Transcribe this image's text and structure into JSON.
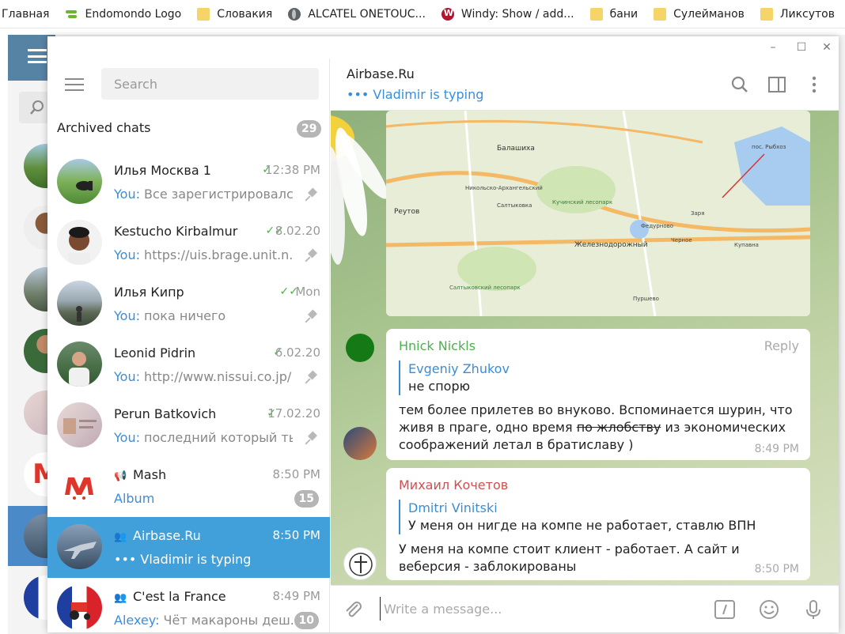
{
  "bookmarks": [
    {
      "label": "Главная",
      "icon": "none"
    },
    {
      "label": "Endomondo Logo",
      "icon": "endomondo-icon"
    },
    {
      "label": "Словакия",
      "icon": "folder-icon"
    },
    {
      "label": "ALCATEL ONETOUC...",
      "icon": "globe-icon"
    },
    {
      "label": "Windy: Show / add...",
      "icon": "windy-icon"
    },
    {
      "label": "бани",
      "icon": "folder-icon"
    },
    {
      "label": "Сулейманов",
      "icon": "folder-icon"
    },
    {
      "label": "Ликсутов",
      "icon": "folder-icon"
    }
  ],
  "window": {
    "minimize": "–",
    "maximize": "☐",
    "close": "✕"
  },
  "sidebar": {
    "search_placeholder": "Search",
    "archived_label": "Archived chats",
    "archived_count": "29",
    "chats": [
      {
        "name": "Илья Москва 1",
        "time": "12:38 PM",
        "you": "You:",
        "preview": " Все зарегистрировалс...",
        "check": "✓",
        "pinned": true
      },
      {
        "name": "Kestucho Kirbalmur",
        "time": "8.02.20",
        "you": "You:",
        "preview": " https://uis.brage.unit.n...",
        "check": "✓✓",
        "pinned": true
      },
      {
        "name": "Илья Кипр",
        "time": "Mon",
        "you": "You:",
        "preview": " пока ничего",
        "check": "✓✓",
        "pinned": true
      },
      {
        "name": "Leonid Pidrin",
        "time": "6.02.20",
        "you": "You:",
        "preview": " http://www.nissui.co.jp/...",
        "check": "✓",
        "pinned": true
      },
      {
        "name": "Perun Batkovich",
        "time": "17.02.20",
        "you": "You:",
        "preview": " последний который ты...",
        "check": "✓",
        "pinned": true
      },
      {
        "name": "Mash",
        "time": "8:50 PM",
        "you": "",
        "preview": "Album",
        "badge": "15"
      },
      {
        "name": "Airbase.Ru",
        "time": "8:50 PM",
        "you": "",
        "preview": "••• Vladimir is typing"
      },
      {
        "name": "C'est la France",
        "time": "8:49 PM",
        "you": "Alexey:",
        "preview": " Чёт макароны деш...",
        "badge": "10"
      }
    ]
  },
  "chat": {
    "title": "Airbase.Ru",
    "status": "••• Vladimir is typing",
    "map_labels": [
      "Балашиха",
      "Реутов",
      "Никольско-Архангельский",
      "Салтыковка",
      "Кучинский лесопарк",
      "Железнодорожный",
      "Федурново",
      "Купавна",
      "Пуршево",
      "Заря",
      "Черное",
      "пос. Рыбхоз",
      "Салтыковский лесопарк"
    ],
    "messages": [
      {
        "author": "Hnick Nickls",
        "author_color": "#4fae4e",
        "reply_label": "Reply",
        "quote_author": "Evgeniy Zhukov",
        "quote_text": "не спорю",
        "text_before": "тем более прилетев во внуково. Вспоминается шурин, что живя в праге, одно время ",
        "text_strike": "по жлобству",
        "text_after": " из экономических соображений летал в братиславу )",
        "time": "8:49 PM"
      },
      {
        "author": "Михаил Кочетов",
        "author_color": "#d14f4f",
        "quote_author": "Dmitri Vinitski",
        "quote_text": "У меня он нигде на компе не работает, ставлю ВПН",
        "text": "У меня на компе стоит клиент - работает. А сайт и веберсия - заблокированы",
        "time": "8:50 PM"
      }
    ],
    "composer_placeholder": "Write a message..."
  },
  "colors": {
    "accent": "#419fd9",
    "link": "#3a8ed8",
    "check": "#4fae4e"
  }
}
